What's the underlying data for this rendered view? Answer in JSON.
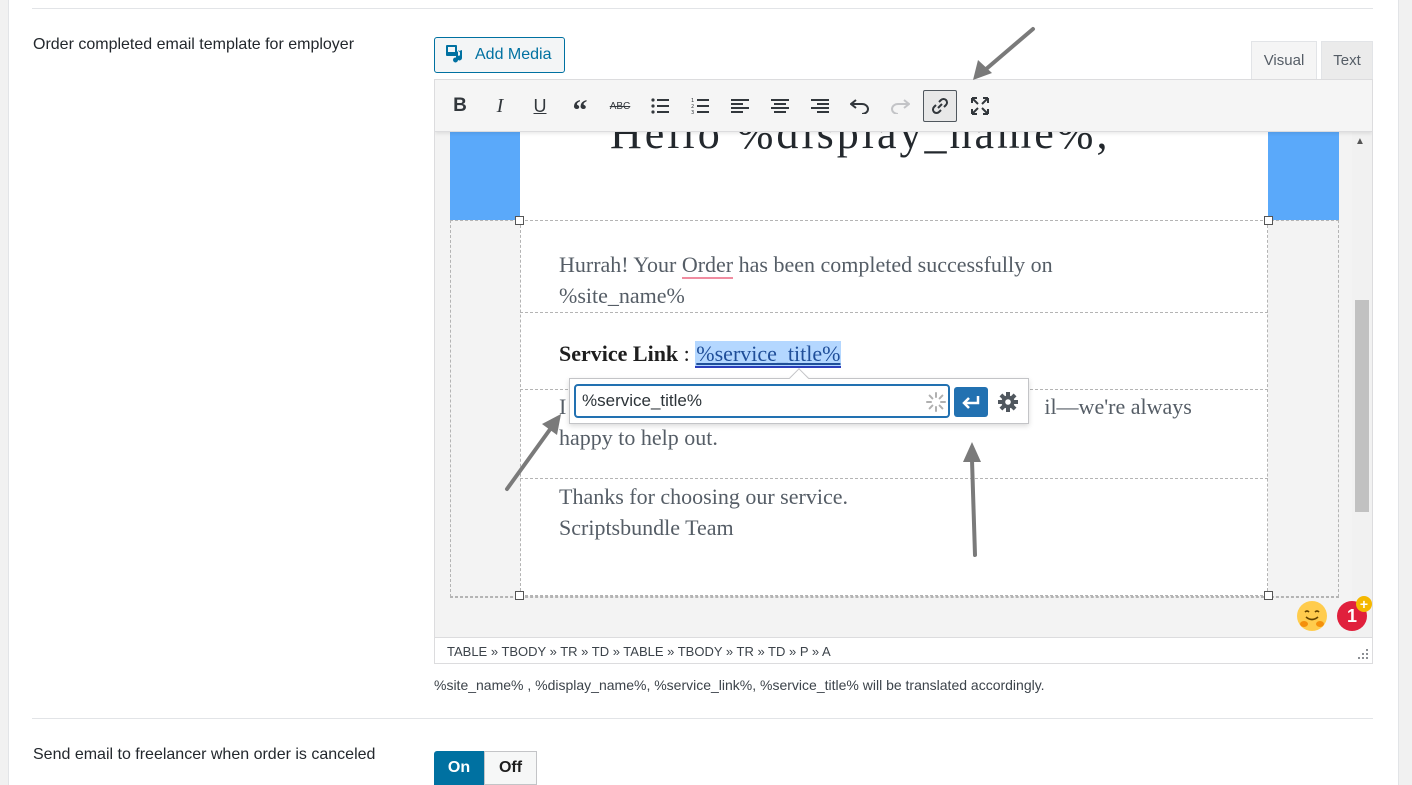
{
  "settings": {
    "template_label": "Order completed email template for employer",
    "cancel_label": "Send email to freelancer when order is canceled",
    "help_text": "%site_name% , %display_name%, %service_link%, %service_title% will be translated accordingly."
  },
  "editor": {
    "add_media": "Add Media",
    "tabs": {
      "visual": "Visual",
      "text": "Text"
    },
    "toolbar": [
      {
        "name": "bold-button",
        "icon": "bold-icon"
      },
      {
        "name": "italic-button",
        "icon": "italic-icon"
      },
      {
        "name": "underline-button",
        "icon": "underline-icon"
      },
      {
        "name": "blockquote-button",
        "icon": "quote-icon"
      },
      {
        "name": "strikethrough-button",
        "icon": "strikethrough-icon"
      },
      {
        "name": "bullet-list-button",
        "icon": "bullet-list-icon"
      },
      {
        "name": "numbered-list-button",
        "icon": "numbered-list-icon"
      },
      {
        "name": "align-left-button",
        "icon": "align-left-icon"
      },
      {
        "name": "align-center-button",
        "icon": "align-center-icon"
      },
      {
        "name": "align-right-button",
        "icon": "align-right-icon"
      },
      {
        "name": "undo-button",
        "icon": "undo-icon"
      },
      {
        "name": "redo-button",
        "icon": "redo-icon"
      },
      {
        "name": "link-button",
        "icon": "link-icon"
      },
      {
        "name": "fullscreen-button",
        "icon": "fullscreen-icon"
      }
    ],
    "content": {
      "hello": "Hello %display_name%,",
      "line1_a": "Hurrah! Your ",
      "line1_order": "Order",
      "line1_b": " has been completed successfully on",
      "line1_c": "%site_name%",
      "service_label": "Service Link",
      "service_sep": " : ",
      "service_value": "%service_title%",
      "line3_prefix": "I",
      "line3_suffix": "il—we're always",
      "line3_b": "happy to help out.",
      "thanks": "Thanks for choosing our service.",
      "team": "Scriptsbundle Team"
    },
    "link_popup": {
      "value": "%service_title%"
    },
    "statusbar": "TABLE » TBODY » TR » TD » TABLE » TBODY » TR » TD » P » A"
  },
  "badge": {
    "count": "1",
    "plus": "+"
  },
  "toggle": {
    "on": "On",
    "off": "Off"
  }
}
